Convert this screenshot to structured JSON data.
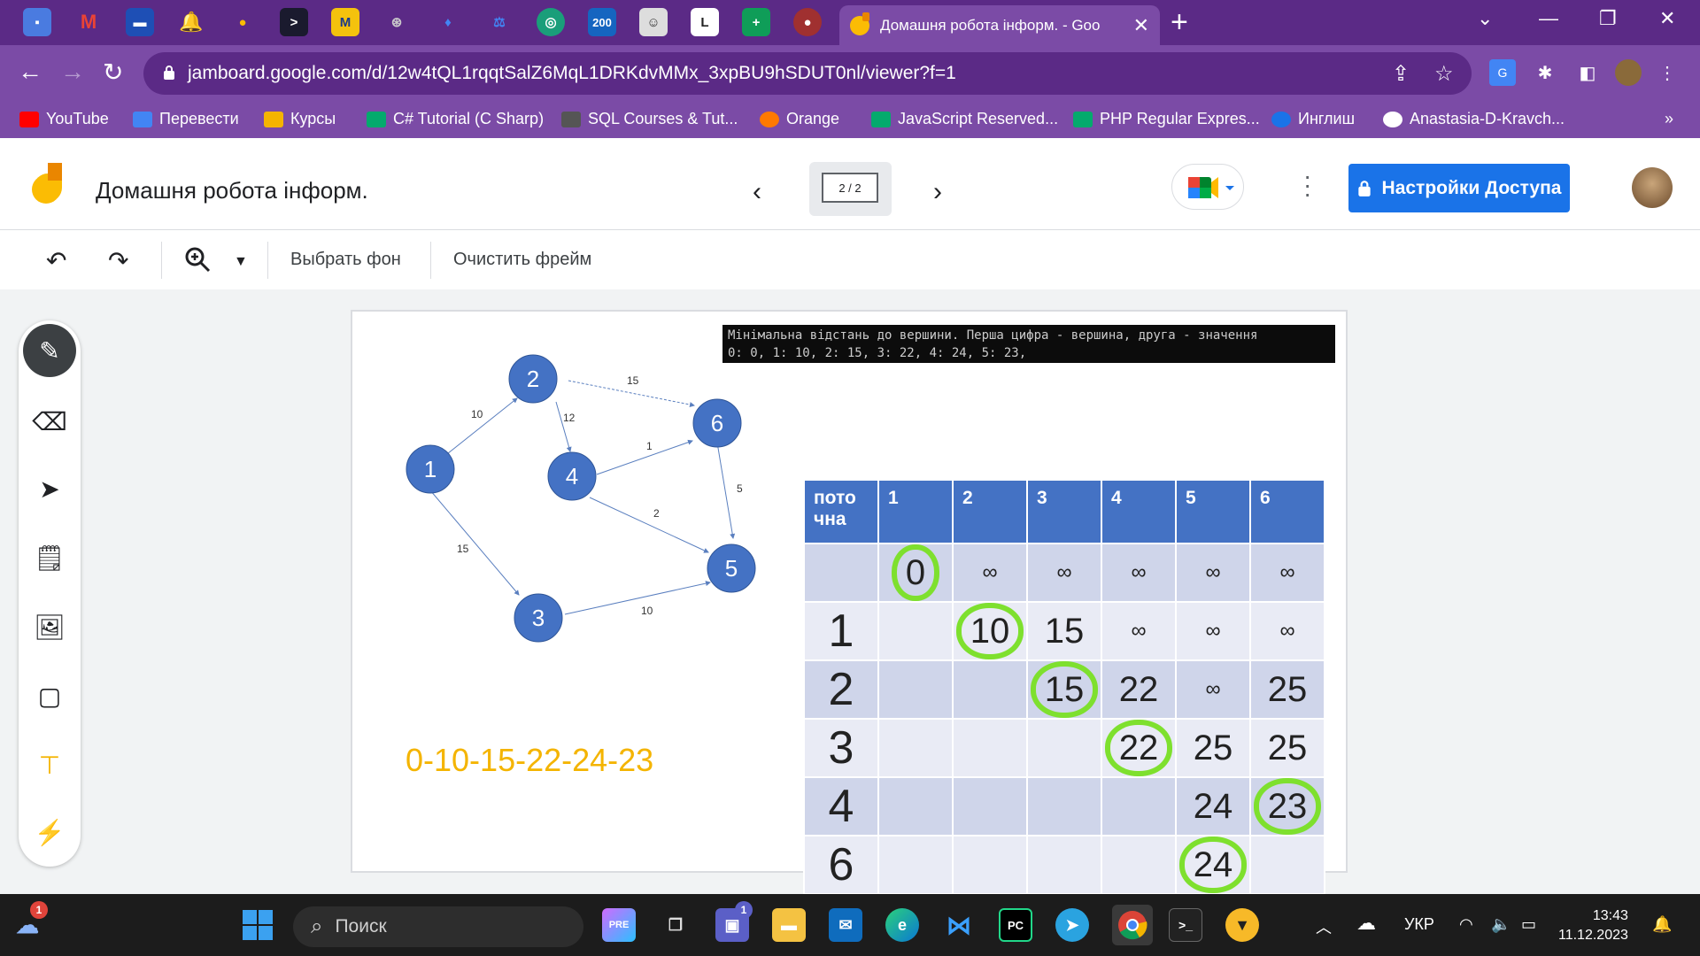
{
  "browser": {
    "active_tab_title": "Домашня робота інформ. - Goo",
    "pinned_tab_badge": "200",
    "url": "jamboard.google.com/d/12w4tQL1rqqtSalZ6MqL1DRKdvMMx_3xpBU9hSDUT0nl/viewer?f=1",
    "bookmarks": [
      {
        "label": "YouTube",
        "color": "#ff0000"
      },
      {
        "label": "Перевести",
        "color": "#4285f4"
      },
      {
        "label": "Курсы",
        "color": "#f4b400"
      },
      {
        "label": "C# Tutorial (C Sharp)",
        "color": "#04aa6d"
      },
      {
        "label": "SQL Courses & Tut...",
        "color": "#555555"
      },
      {
        "label": "Orange",
        "color": "#ff7900"
      },
      {
        "label": "JavaScript Reserved...",
        "color": "#04aa6d"
      },
      {
        "label": "PHP Regular Expres...",
        "color": "#04aa6d"
      },
      {
        "label": "Инглиш",
        "color": "#1a73e8"
      },
      {
        "label": "Anastasia-D-Kravch...",
        "color": "#ffffff"
      }
    ],
    "bookmarks_overflow": "»"
  },
  "header": {
    "doc_title": "Домашня робота інформ.",
    "frame_indicator": "2 / 2",
    "share_label": "Настройки Доступа"
  },
  "toolbar": {
    "background_label": "Выбрать фон",
    "clear_label": "Очистить фрейм"
  },
  "frame": {
    "console_line1": "Мінімальна відстань до вершини. Перша цифра - вершина, друга - значення",
    "console_line2": "0: 0, 1: 10, 2: 15, 3: 22, 4: 24, 5: 23,",
    "answer_text": "0-10-15-22-24-23",
    "graph": {
      "nodes": [
        "1",
        "2",
        "3",
        "4",
        "5",
        "6"
      ],
      "edges": [
        {
          "from": "1",
          "to": "2",
          "weight": "10"
        },
        {
          "from": "1",
          "to": "3",
          "weight": "15"
        },
        {
          "from": "2",
          "to": "4",
          "weight": "12"
        },
        {
          "from": "2",
          "to": "6",
          "weight": "15"
        },
        {
          "from": "4",
          "to": "6",
          "weight": "1"
        },
        {
          "from": "4",
          "to": "5",
          "weight": "2"
        },
        {
          "from": "6",
          "to": "5",
          "weight": "5"
        },
        {
          "from": "3",
          "to": "5",
          "weight": "10"
        }
      ]
    },
    "table": {
      "headers": [
        "пото чна",
        "1",
        "2",
        "3",
        "4",
        "5",
        "6"
      ],
      "rows": [
        [
          "",
          "0",
          "∞",
          "∞",
          "∞",
          "∞",
          "∞"
        ],
        [
          "1",
          "",
          "10",
          "15",
          "∞",
          "∞",
          "∞"
        ],
        [
          "2",
          "",
          "",
          "15",
          "22",
          "∞",
          "25"
        ],
        [
          "3",
          "",
          "",
          "",
          "22",
          "25",
          "25"
        ],
        [
          "4",
          "",
          "",
          "",
          "",
          "24",
          "23"
        ],
        [
          "6",
          "",
          "",
          "",
          "",
          "24",
          ""
        ],
        [
          "",
          "",
          "",
          "",
          "",
          "",
          ""
        ]
      ]
    },
    "highlight_color": "#7ee02e",
    "node_color": "#4472c4",
    "answer_color": "#f4b400"
  },
  "taskbar": {
    "search_placeholder": "Поиск",
    "weather_badge": "1",
    "teams_badge": "1",
    "lang": "УКР",
    "time": "13:43",
    "date": "11.12.2023"
  }
}
